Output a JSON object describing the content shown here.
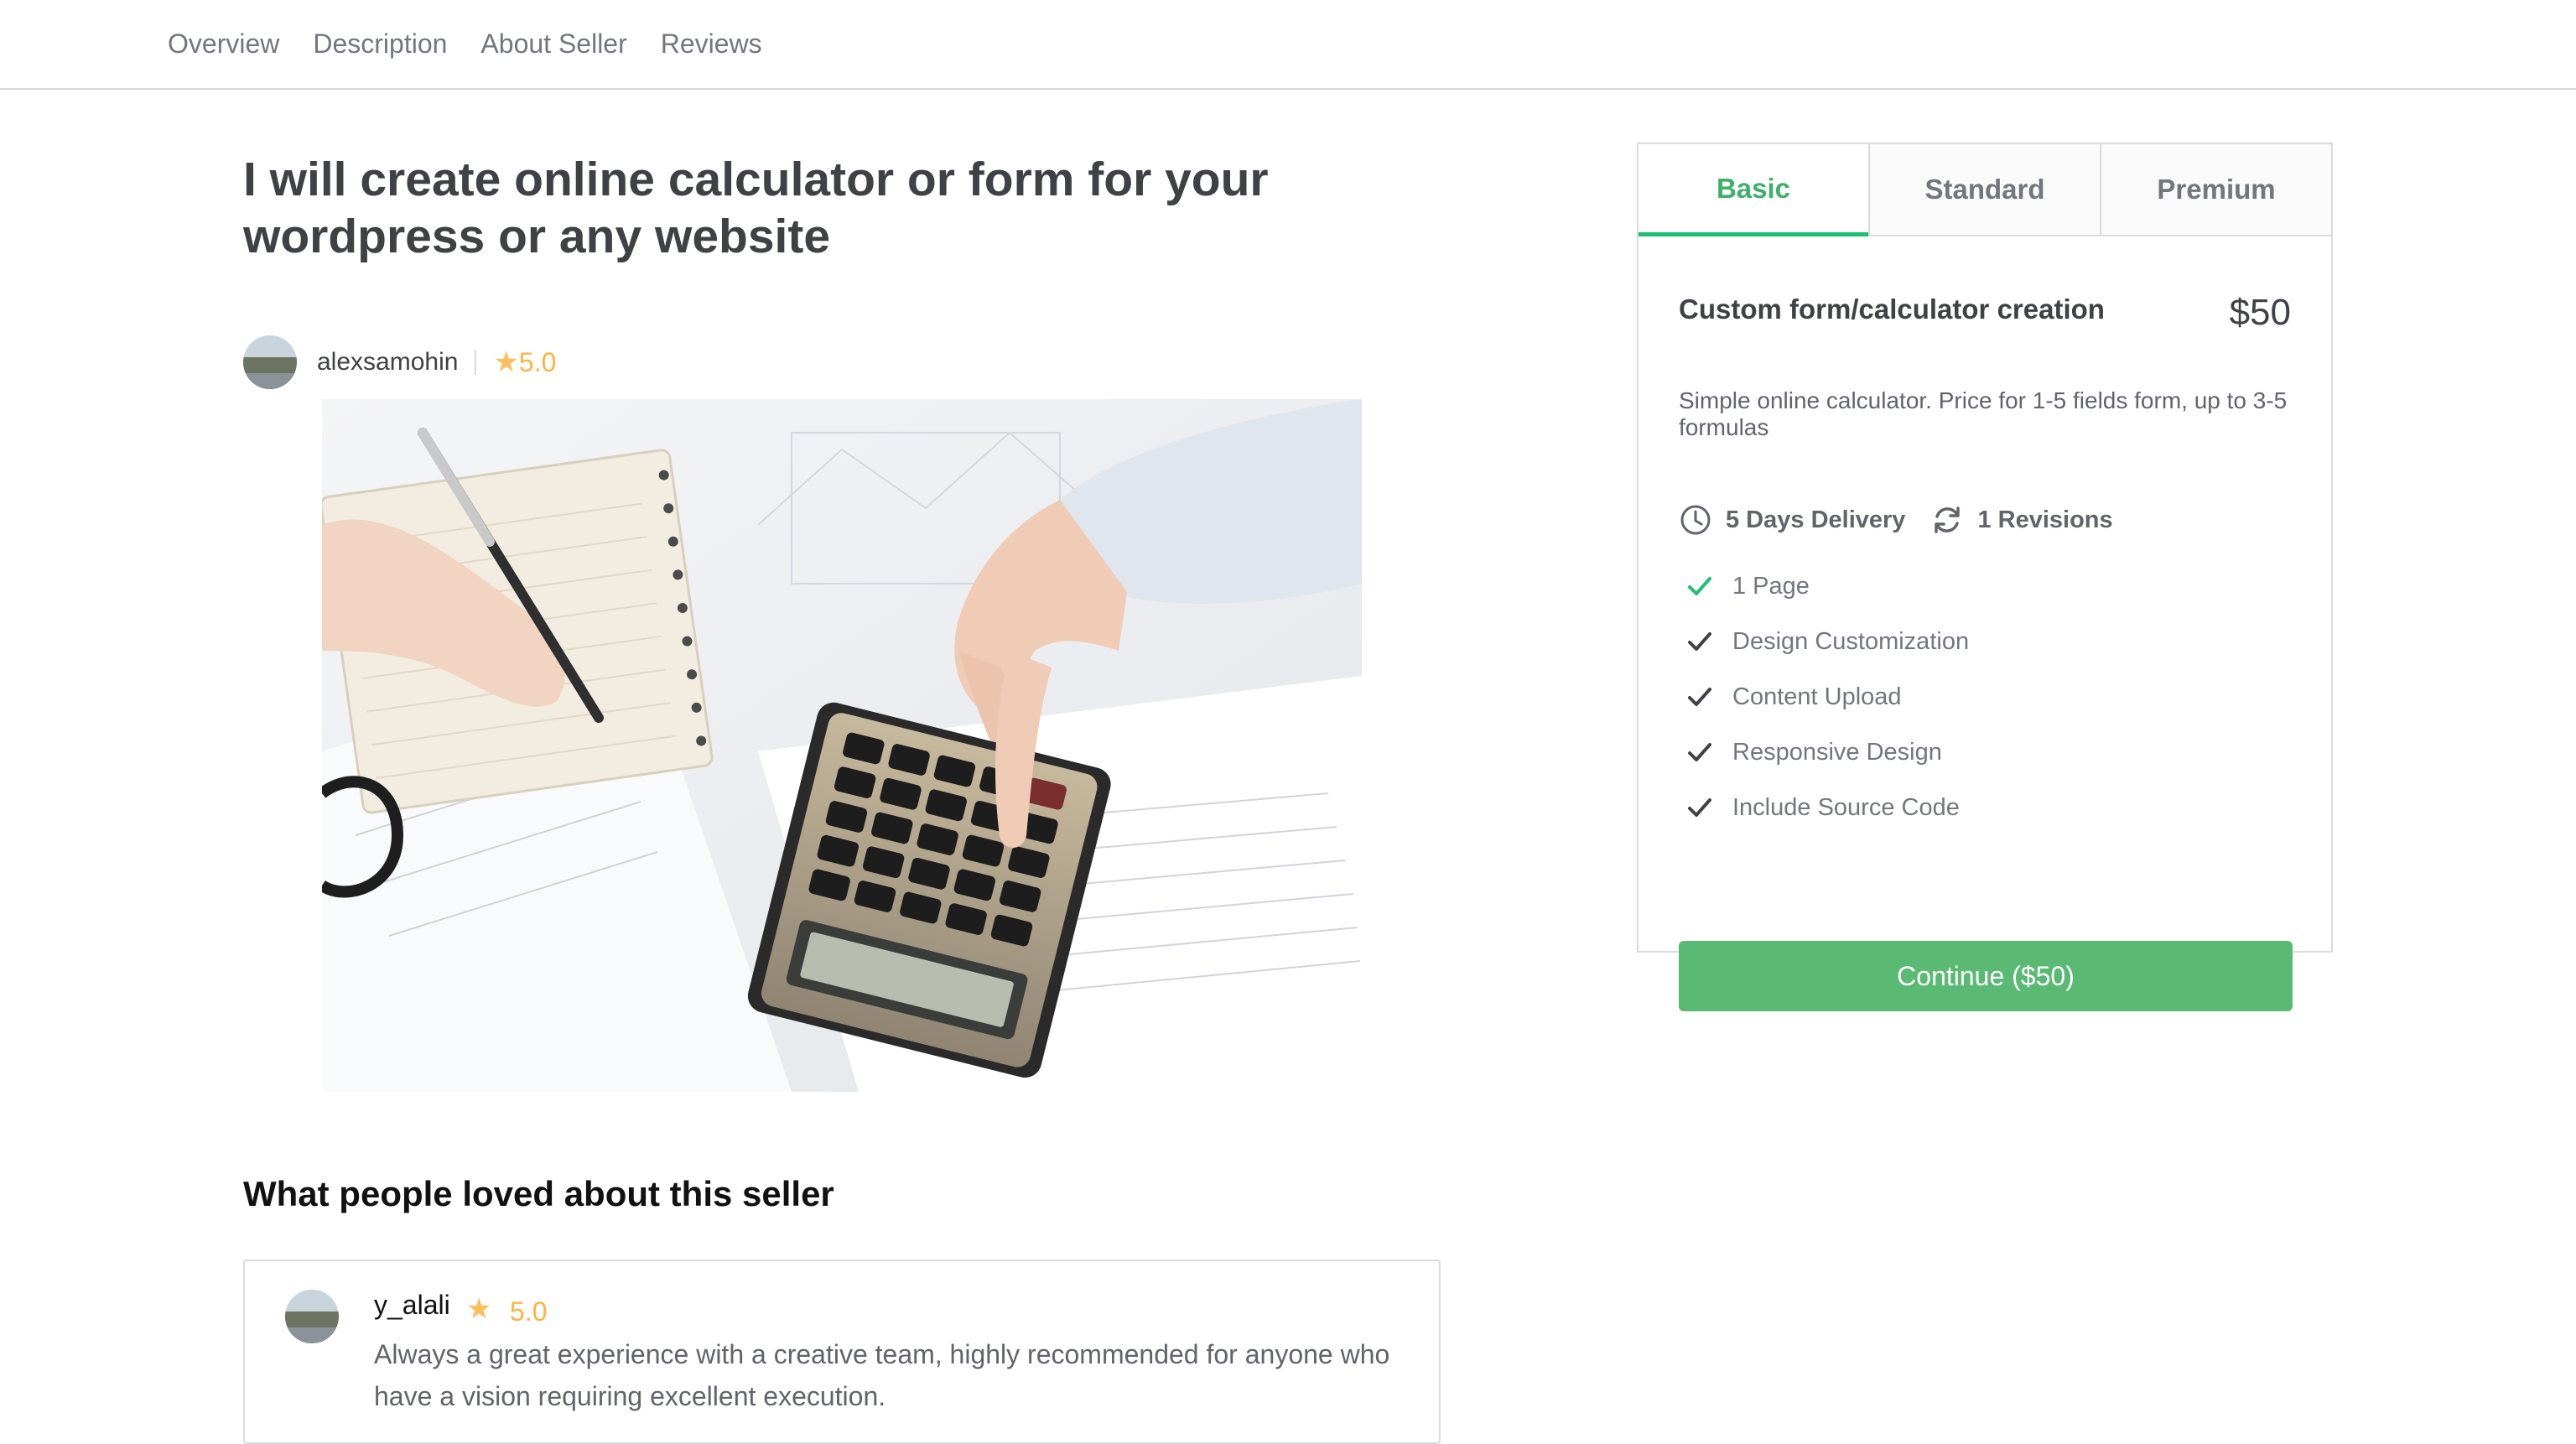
{
  "nav": {
    "items": [
      {
        "label": "Overview"
      },
      {
        "label": "Description"
      },
      {
        "label": "About Seller"
      },
      {
        "label": "Reviews"
      }
    ]
  },
  "gig": {
    "title": "I will create online calculator or form for your wordpress or any website",
    "seller": "alexsamohin",
    "rating": "5.0"
  },
  "loved": {
    "heading": "What people loved about this seller",
    "review": {
      "name": "y_alali",
      "rating": "5.0",
      "text": "Always a great experience with a creative team, highly recommended for anyone who have a vision requiring excellent execution."
    }
  },
  "package": {
    "tabs": [
      {
        "label": "Basic"
      },
      {
        "label": "Standard"
      },
      {
        "label": "Premium"
      }
    ],
    "active_tab": "Basic",
    "name": "Custom form/calculator creation",
    "price": "$50",
    "description": "Simple online calculator. Price for 1-5 fields form, up to 3-5 formulas",
    "delivery": "5 Days Delivery",
    "revisions": "1 Revisions",
    "features": [
      {
        "label": "1 Page"
      },
      {
        "label": "Design Customization"
      },
      {
        "label": "Content Upload"
      },
      {
        "label": "Responsive Design"
      },
      {
        "label": "Include Source Code"
      }
    ],
    "continue_label": "Continue ($50)"
  },
  "colors": {
    "accent_green": "#5aba74",
    "star": "#ffbe5b",
    "text": "#404145",
    "muted": "#74767e"
  }
}
